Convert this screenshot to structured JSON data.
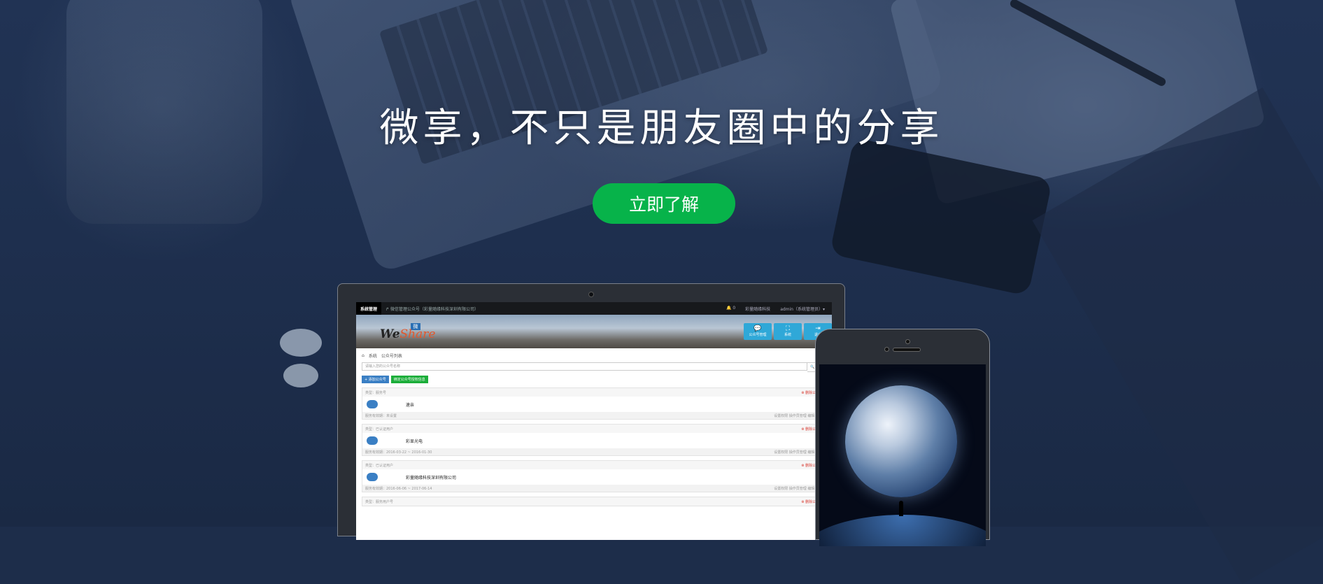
{
  "hero": {
    "slogan": "微享，不只是朋友圈中的分享",
    "cta_label": "立即了解"
  },
  "colors": {
    "background": "#1d2d4a",
    "cta": "#07b34a",
    "accent_blue": "#2fa8d8"
  },
  "laptop_screen": {
    "topbar": {
      "brand": "系统管理",
      "crumb": "↱ 微信管理公众号（彩量随缘科技深圳有限公司）",
      "bell": "🔔 0",
      "company": "彩量随缘科技",
      "user": "admin（系统管理员）▾"
    },
    "logo_text_a": "We",
    "logo_text_b": "Share",
    "logo_badge": "微",
    "header_buttons": [
      {
        "icon": "chat-icon",
        "glyph": "💬",
        "label": "公众号管理"
      },
      {
        "icon": "org-icon",
        "glyph": "⛶",
        "label": "系统"
      },
      {
        "icon": "logout-icon",
        "glyph": "⇥",
        "label": "退出"
      }
    ],
    "breadcrumb": [
      "⌂",
      "系统",
      "公众号列表"
    ],
    "search_placeholder": "请输入您的公众号名称",
    "search_button": "🔍 搜索",
    "add_button": "+ 添加公众号",
    "bind_button": "绑定公众号授权信息",
    "accounts": [
      {
        "type": "类型：服务号",
        "name": "速亲",
        "period": "服务有效期：未设置",
        "delete": "⊗ 删除公众号",
        "actions": "设置权限  操作员管理  编辑  删除"
      },
      {
        "type": "类型：已认证用户",
        "name": "彩显光电",
        "period": "服务有效期：2016-03-22 ~ 2016-01-30",
        "delete": "⊗ 删除公众号",
        "actions": "设置权限  操作员管理  编辑  删除"
      },
      {
        "type": "类型：已认证用户",
        "name": "彩量随缘科技深圳有限公司",
        "period": "服务有效期：2016-06-06 ~ 2017-06-14",
        "delete": "⊗ 删除公众号",
        "actions": "设置权限  操作员管理  编辑  删除"
      },
      {
        "type": "类型：服务用户号",
        "name": "",
        "period": "",
        "delete": "⊗ 删除公众号",
        "actions": ""
      }
    ]
  }
}
